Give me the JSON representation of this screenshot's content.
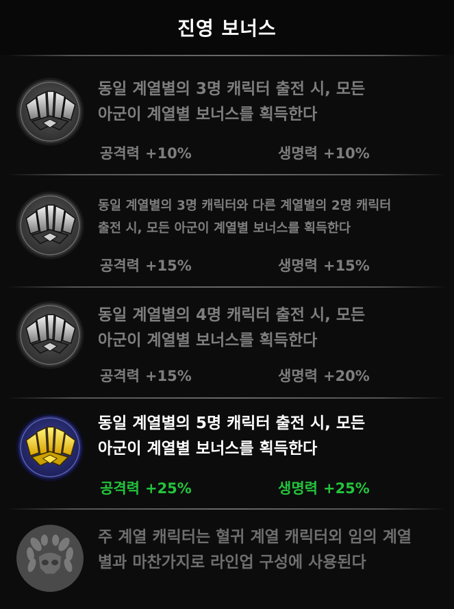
{
  "header": {
    "title": "진영 보너스"
  },
  "tiers": [
    {
      "line1": "동일 계열별의 3명 캐릭터 출전 시, 모든",
      "line2": "아군이 계열별 보너스를 획득한다",
      "atk_label": "공격력",
      "atk_value": "+10%",
      "hp_label": "생명력",
      "hp_value": "+10%",
      "active": false
    },
    {
      "line1": "동일 계열별의 3명 캐릭터와 다른 계열별의 2명 캐릭터",
      "line2": "출전 시, 모든 아군이 계열별 보너스를 획득한다",
      "atk_label": "공격력",
      "atk_value": "+15%",
      "hp_label": "생명력",
      "hp_value": "+15%",
      "active": false
    },
    {
      "line1": "동일 계열별의 4명 캐릭터 출전 시, 모든",
      "line2": "아군이 계열별 보너스를 획득한다",
      "atk_label": "공격력",
      "atk_value": "+15%",
      "hp_label": "생명력",
      "hp_value": "+20%",
      "active": false
    },
    {
      "line1": "동일 계열별의 5명 캐릭터 출전 시, 모든",
      "line2": "아군이 계열별 보너스를 획득한다",
      "atk_label": "공격력",
      "atk_value": "+25%",
      "hp_label": "생명력",
      "hp_value": "+25%",
      "active": true
    }
  ],
  "note": {
    "line1": "주 계열 캐릭터는 혈귀 계열 캐릭터외 임의 계열",
    "line2": "별과 마찬가지로 라인업 구성에 사용된다"
  },
  "colors": {
    "active_stat": "#23c43c",
    "inactive_text": "#7e7e7e",
    "active_emblem_gold": "#f2c500",
    "active_emblem_ring": "#2a2f7a"
  }
}
